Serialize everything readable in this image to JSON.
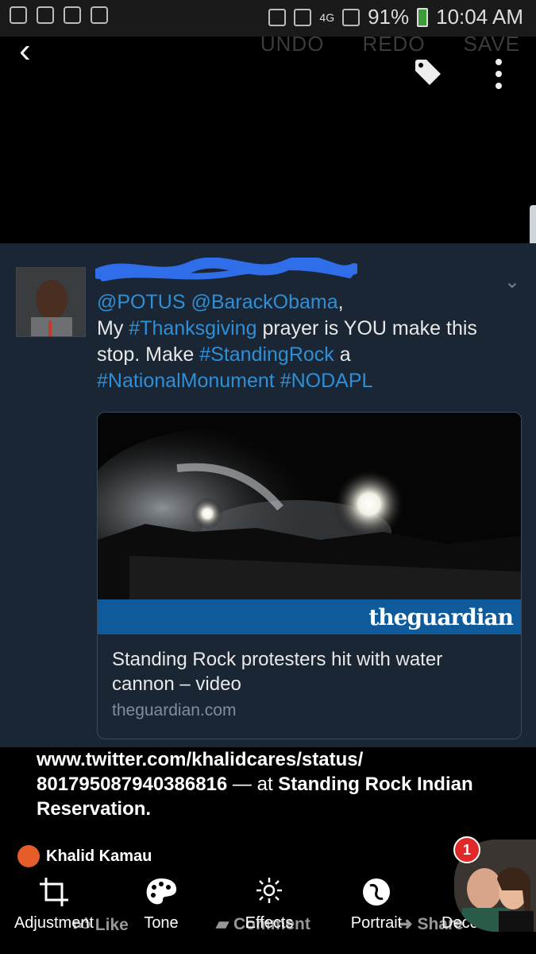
{
  "status_bar": {
    "network": "4G",
    "battery": "91%",
    "time": "10:04 AM"
  },
  "editor": {
    "undo": "UNDO",
    "redo": "REDO",
    "save": "SAVE"
  },
  "tweet": {
    "mentions": [
      "@POTUS",
      "@BarackObama"
    ],
    "text_line1": "My ",
    "hashtag_thanks": "#Thanksgiving",
    "text_mid": " prayer is YOU make this stop. Make ",
    "hashtag_standing": "#StandingRock",
    "text_a": " a",
    "hashtag_monument": "#NationalMonument",
    "hashtag_nodapl": "#NODAPL",
    "card": {
      "logo": "theguardian",
      "title": "Standing Rock protesters hit with water cannon – video",
      "domain": "theguardian.com"
    }
  },
  "post": {
    "url_part1": "www.twitter.com/khalidcares/status/",
    "url_part2": "801795087940386816",
    "at_text": " — at ",
    "location": "Standing Rock Indian Reservation",
    "period": "."
  },
  "reaction": {
    "name": "Khalid Kamau"
  },
  "chat_head": {
    "badge": "1"
  },
  "tools": [
    {
      "label": "Adjustment",
      "icon": "crop-icon"
    },
    {
      "label": "Tone",
      "icon": "palette-icon"
    },
    {
      "label": "Effects",
      "icon": "sparkle-icon"
    },
    {
      "label": "Portrait",
      "icon": "portrait-icon"
    },
    {
      "label": "Decoration"
    }
  ],
  "fb_actions": {
    "like": "Like",
    "comment": "Comment",
    "share": "Share"
  },
  "colors": {
    "card_bg": "#1a2634",
    "link": "#2f8fd6",
    "guardian_blue": "#0f5a9a"
  }
}
